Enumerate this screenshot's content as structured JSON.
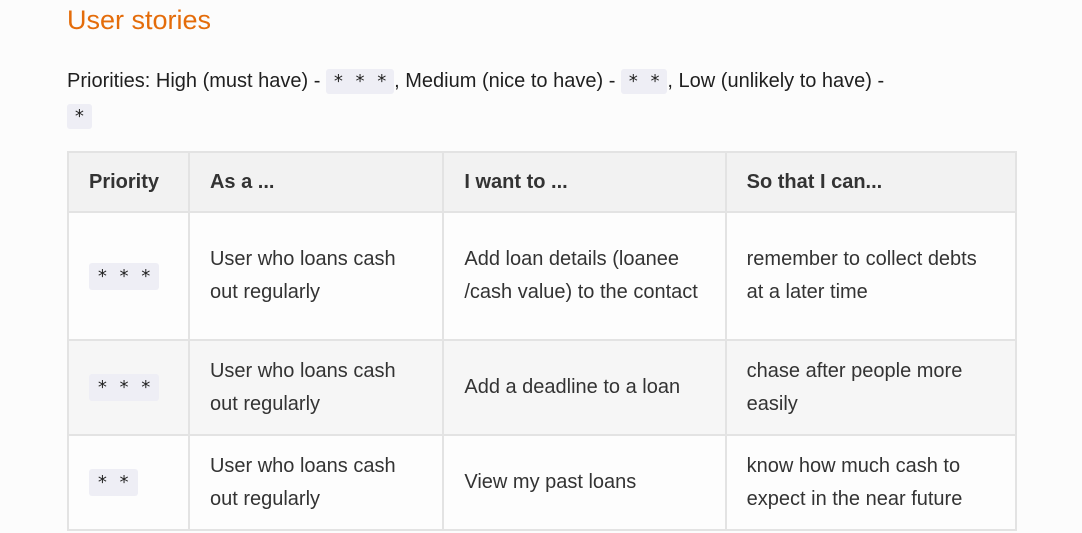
{
  "section": {
    "title": "User stories"
  },
  "priorities": {
    "prefix": "Priorities: High (must have) - ",
    "high_code": "* * *",
    "medium_text": ", Medium (nice to have) - ",
    "medium_code": "* *",
    "low_text": ", Low (unlikely to have) - ",
    "low_code": "*"
  },
  "table": {
    "headers": [
      "Priority",
      "As a ...",
      "I want to ...",
      "So that I can..."
    ],
    "rows": [
      {
        "priority": "* * *",
        "as_a": "User who loans cash out regularly",
        "want": "Add loan details (loanee /cash value) to the contact",
        "so_that": "remember to collect debts at a later time"
      },
      {
        "priority": "* * *",
        "as_a": "User who loans cash out regularly",
        "want": "Add a deadline to a loan",
        "so_that": "chase after people more easily"
      },
      {
        "priority": "* *",
        "as_a": "User who loans cash out regularly",
        "want": "View my past loans",
        "so_that": "know how much cash to expect in the near future"
      }
    ]
  }
}
